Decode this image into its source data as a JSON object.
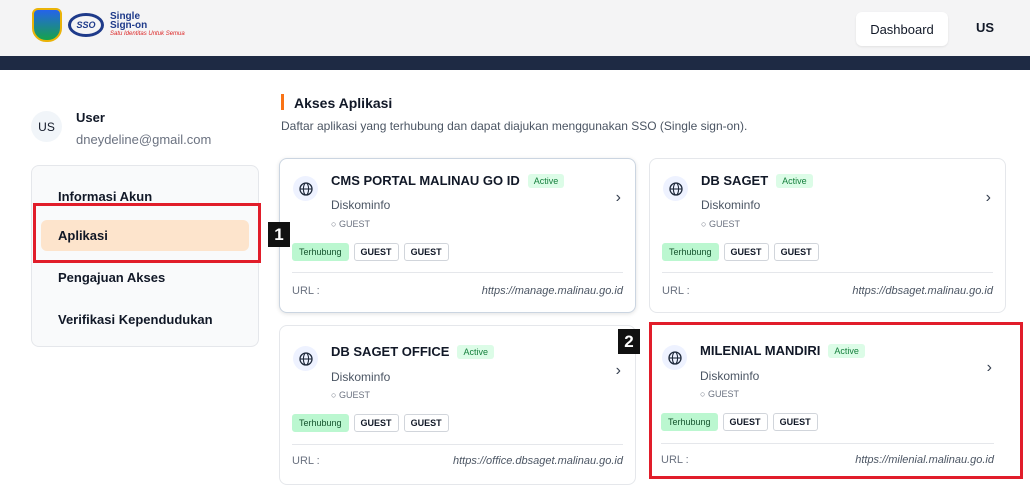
{
  "header": {
    "logo_sso": "SSO",
    "logo_title": "Single Sign-on",
    "logo_tagline": "Satu Identitas Untuk Semua",
    "dashboard_label": "Dashboard",
    "avatar_initials": "US"
  },
  "user": {
    "initials": "US",
    "name": "User",
    "email": "dneydeline@gmail.com"
  },
  "menu": {
    "items": [
      {
        "label": "Informasi Akun"
      },
      {
        "label": "Aplikasi"
      },
      {
        "label": "Pengajuan Akses"
      },
      {
        "label": "Verifikasi Kependudukan"
      }
    ]
  },
  "annotations": {
    "one": "1",
    "two": "2"
  },
  "section": {
    "title": "Akses Aplikasi",
    "subtitle": "Daftar aplikasi yang terhubung dan dapat diajukan menggunakan SSO (Single sign-on)."
  },
  "apps": [
    {
      "name": "CMS PORTAL MALINAU GO ID",
      "status": "Active",
      "org": "Diskominfo",
      "role": "GUEST",
      "tags": [
        "Terhubung",
        "GUEST",
        "GUEST"
      ],
      "url_label": "URL :",
      "url": "https://manage.malinau.go.id"
    },
    {
      "name": "DB SAGET",
      "status": "Active",
      "org": "Diskominfo",
      "role": "GUEST",
      "tags": [
        "Terhubung",
        "GUEST",
        "GUEST"
      ],
      "url_label": "URL :",
      "url": "https://dbsaget.malinau.go.id"
    },
    {
      "name": "DB SAGET OFFICE",
      "status": "Active",
      "org": "Diskominfo",
      "role": "GUEST",
      "tags": [
        "Terhubung",
        "GUEST",
        "GUEST"
      ],
      "url_label": "URL :",
      "url": "https://office.dbsaget.malinau.go.id"
    },
    {
      "name": "MILENIAL MANDIRI",
      "status": "Active",
      "org": "Diskominfo",
      "role": "GUEST",
      "tags": [
        "Terhubung",
        "GUEST",
        "GUEST"
      ],
      "url_label": "URL :",
      "url": "https://milenial.malinau.go.id"
    }
  ],
  "colors": {
    "accent": "#f97316",
    "nav": "#1e2a44",
    "active_menu": "#fde4cc",
    "highlight": "#e11d2a"
  }
}
